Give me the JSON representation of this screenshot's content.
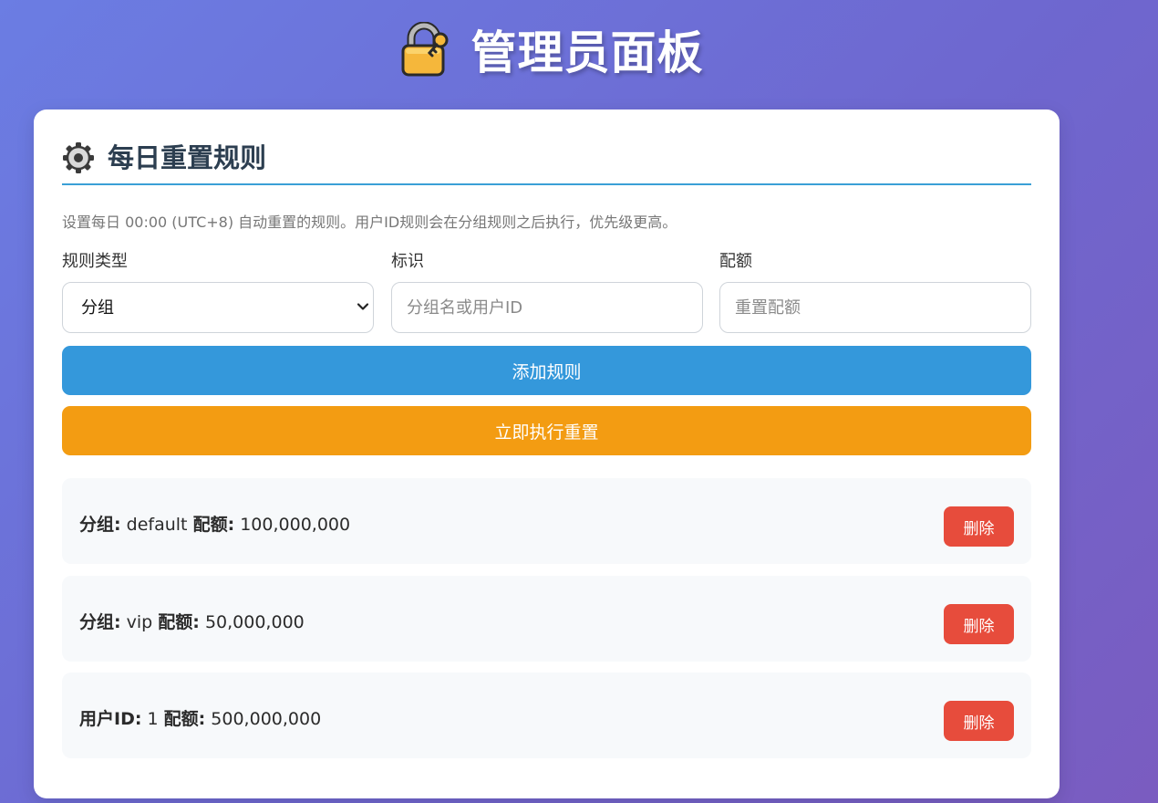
{
  "header": {
    "title": "管理员面板",
    "icon": "lock-with-key-icon"
  },
  "section": {
    "title": "每日重置规则",
    "icon": "gear-icon",
    "description": "设置每日 00:00 (UTC+8) 自动重置的规则。用户ID规则会在分组规则之后执行，优先级更高。"
  },
  "form": {
    "rule_type": {
      "label": "规则类型",
      "selected": "分组"
    },
    "identifier": {
      "label": "标识",
      "placeholder": "分组名或用户ID"
    },
    "quota": {
      "label": "配额",
      "placeholder": "重置配额"
    }
  },
  "buttons": {
    "add_rule": "添加规则",
    "reset_now": "立即执行重置"
  },
  "colors": {
    "accent": "#3498db",
    "reset": "#f39c12",
    "delete": "#e74c3c"
  },
  "rules": [
    {
      "type_label": "分组:",
      "identifier": "default",
      "quota_label": "配额:",
      "quota": "100,000,000",
      "delete_label": "删除"
    },
    {
      "type_label": "分组:",
      "identifier": "vip",
      "quota_label": "配额:",
      "quota": "50,000,000",
      "delete_label": "删除"
    },
    {
      "type_label": "用户ID:",
      "identifier": "1",
      "quota_label": "配额:",
      "quota": "500,000,000",
      "delete_label": "删除"
    }
  ]
}
